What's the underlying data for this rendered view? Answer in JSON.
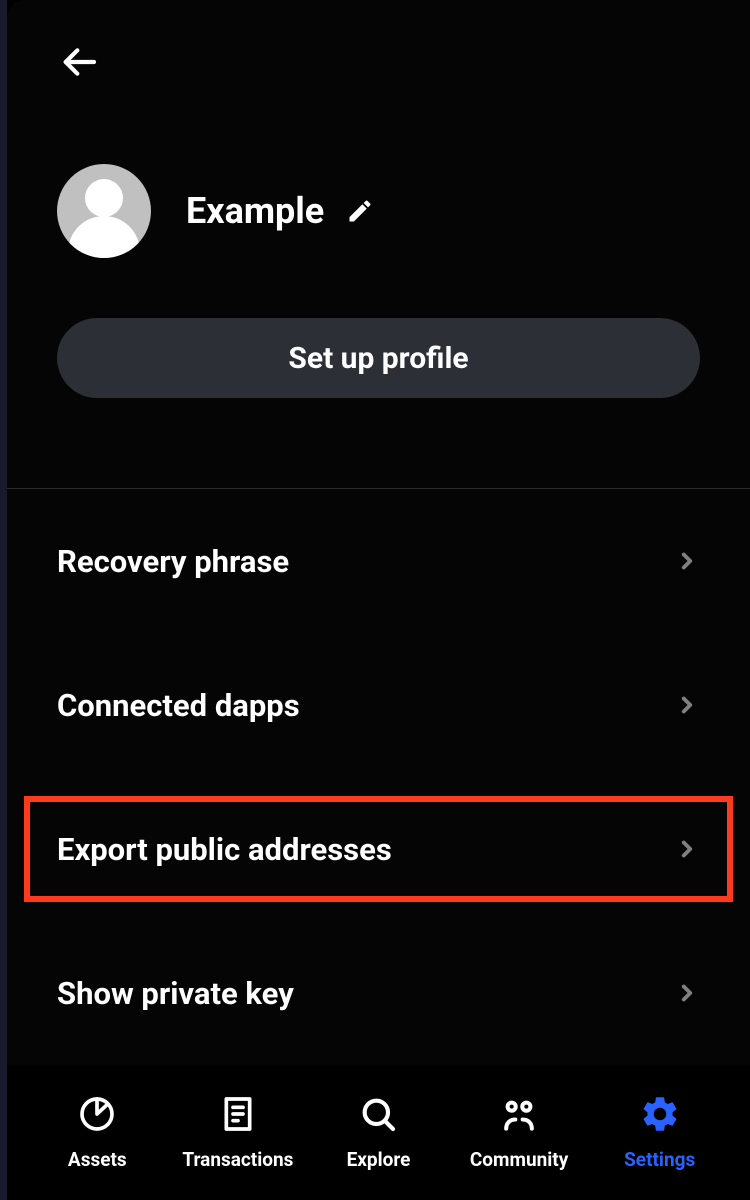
{
  "profile": {
    "name": "Example",
    "setup_button": "Set up profile"
  },
  "settings": {
    "items": [
      {
        "label": "Recovery phrase",
        "highlighted": false
      },
      {
        "label": "Connected dapps",
        "highlighted": false
      },
      {
        "label": "Export public addresses",
        "highlighted": true
      },
      {
        "label": "Show private key",
        "highlighted": false
      }
    ]
  },
  "nav": {
    "items": [
      {
        "label": "Assets",
        "active": false
      },
      {
        "label": "Transactions",
        "active": false
      },
      {
        "label": "Explore",
        "active": false
      },
      {
        "label": "Community",
        "active": false
      },
      {
        "label": "Settings",
        "active": true
      }
    ]
  }
}
